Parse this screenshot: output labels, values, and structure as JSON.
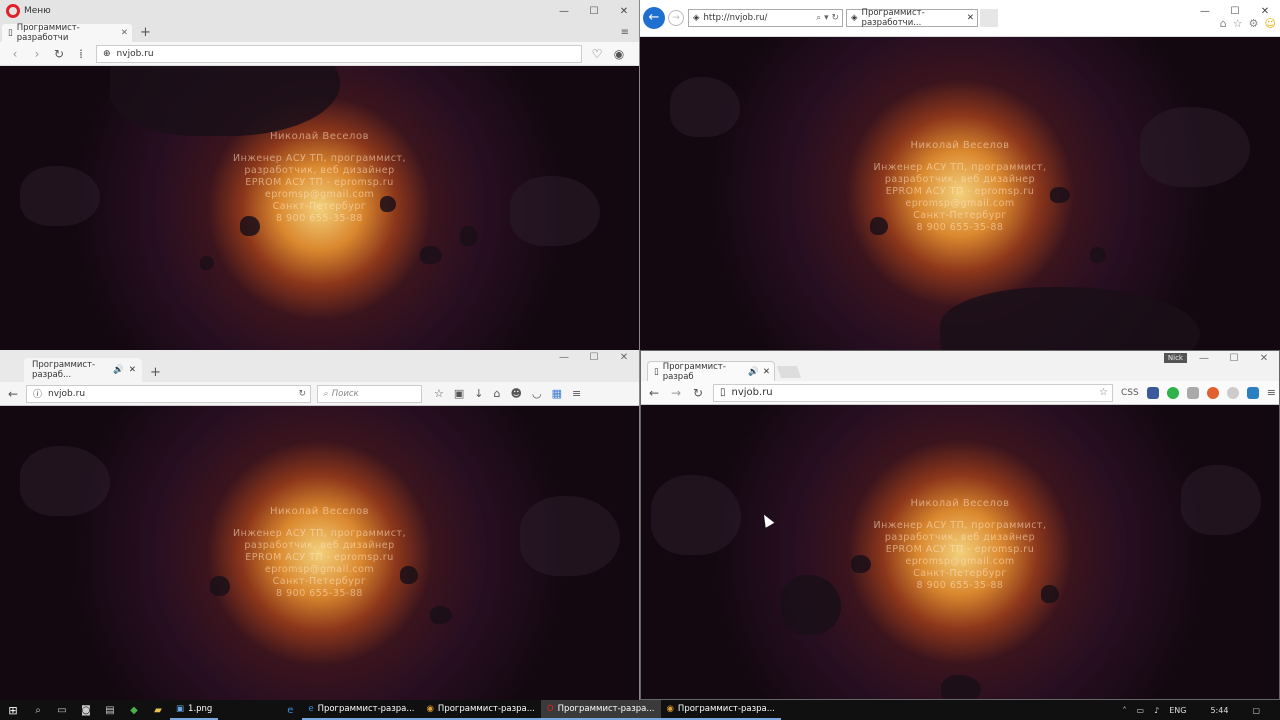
{
  "card": {
    "name": "Николай Веселов",
    "role1": "Инженер АСУ ТП, программист,",
    "role2": "разработчик, веб дизайнер",
    "company": "EPROM АСУ ТП - epromsp.ru",
    "email": "epromsp@gmail.com",
    "city": "Санкт-Петербург",
    "phone": "8 900 655-35-88"
  },
  "opera": {
    "menu_label": "Меню",
    "tab_title": "Программист-разработчи",
    "url": "nvjob.ru",
    "controls": [
      "—",
      "☐",
      "✕"
    ]
  },
  "ie": {
    "url": "http://nvjob.ru/",
    "tab_title": "Программист-разработчи...",
    "controls": [
      "—",
      "☐",
      "✕"
    ]
  },
  "firefox": {
    "tab_title": "Программист-разраб...",
    "url": "nvjob.ru",
    "search_placeholder": "Поиск",
    "controls": [
      "—",
      "☐",
      "✕"
    ]
  },
  "chrome": {
    "tab_title": "Программист-разраб",
    "url": "nvjob.ru",
    "profile": "Nick",
    "css_ext": "CSS",
    "controls": [
      "—",
      "☐",
      "✕"
    ]
  },
  "taskbar": {
    "apps": [
      {
        "label": "1.png",
        "icon": "image-icon"
      },
      {
        "label": "Программист-разра...",
        "icon": "ie-icon"
      },
      {
        "label": "Программист-разра...",
        "icon": "chrome-icon"
      },
      {
        "label": "Программист-разра...",
        "icon": "opera-icon"
      },
      {
        "label": "Программист-разра...",
        "icon": "chrome-icon"
      }
    ],
    "lang": "ENG",
    "time": "5:44"
  }
}
